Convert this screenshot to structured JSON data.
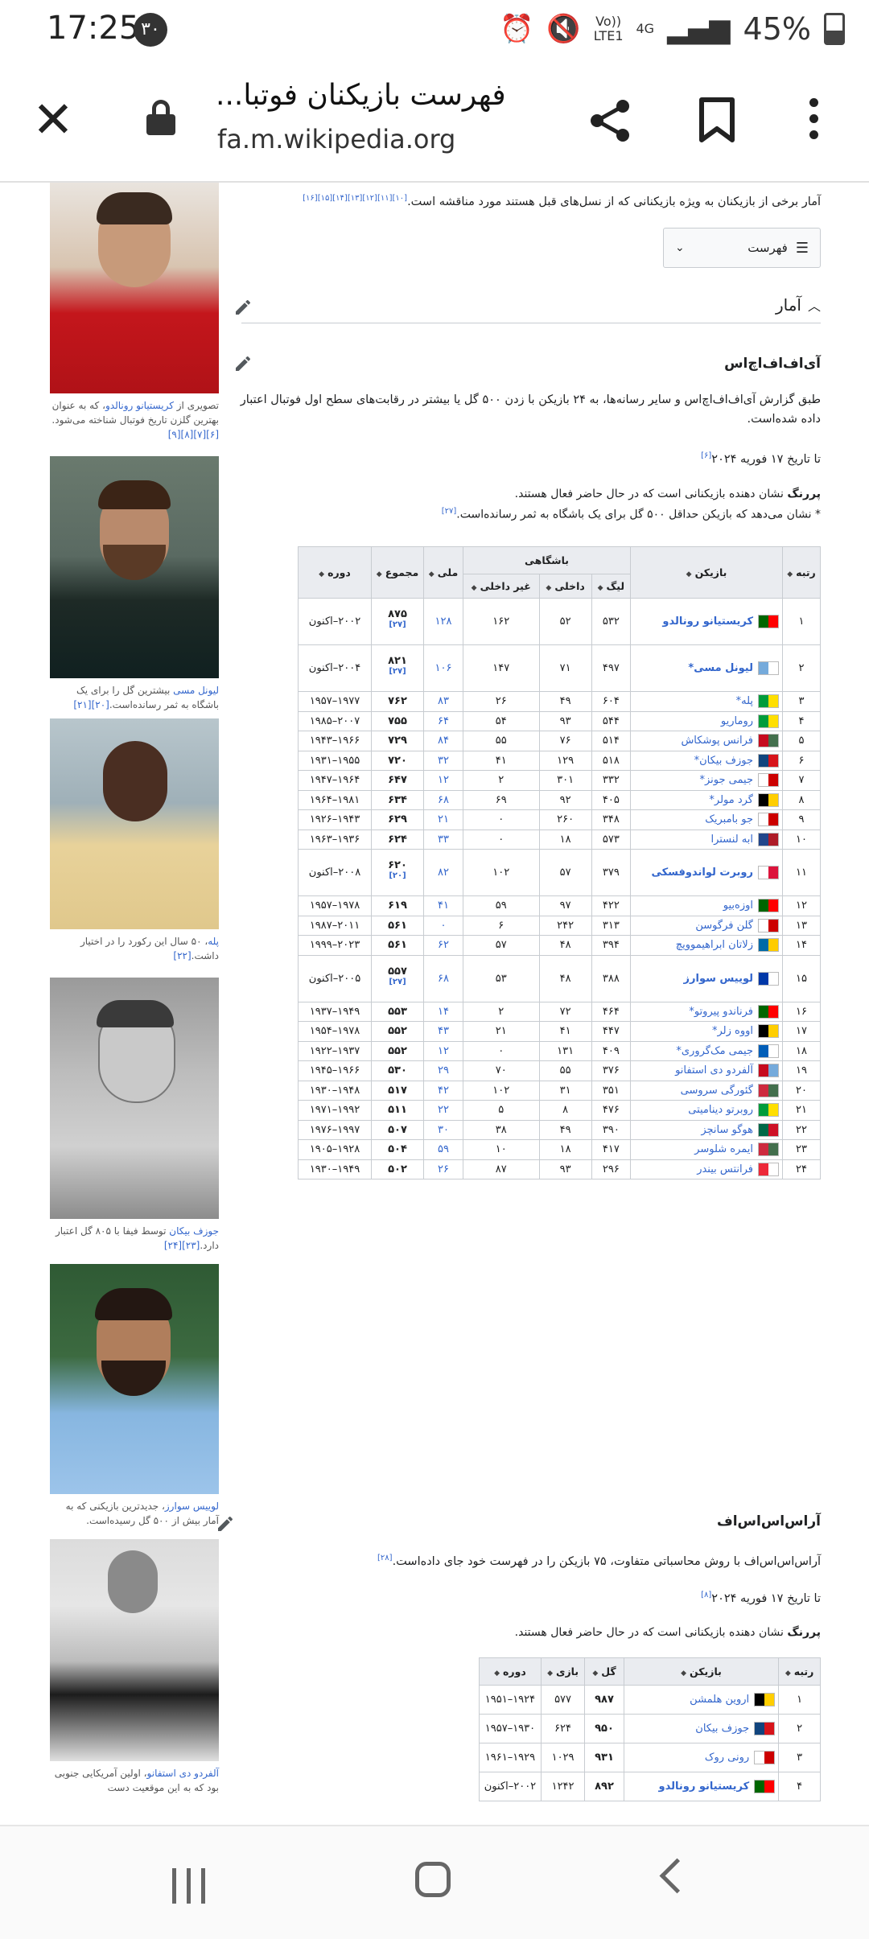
{
  "status": {
    "time": "17:25",
    "badge": "۳۰",
    "net_top": "Vo))",
    "net_bottom": "LTE1",
    "gen": "4G",
    "battery": "45%"
  },
  "browser": {
    "title": "فهرست بازیکنان فوتبا...",
    "url": "fa.m.wikipedia.org"
  },
  "intro": {
    "text": "آمار برخی از بازیکنان به ویژه بازیکنانی که از نسل‌های قبل هستند مورد مناقشه است.",
    "refs": "[۱۰][۱۱][۱۲][۱۳][۱۴][۱۵][۱۶]"
  },
  "toc": {
    "label": "فهرست"
  },
  "section": {
    "title": "آمار"
  },
  "iffhs": {
    "title": "آی‌اف‌اف‌اچ‌اس",
    "para": "طبق گزارش آی‌اف‌اف‌اچ‌اس و سایر رسانه‌ها، به ۲۴ بازیکن با زدن ۵۰۰ گل یا بیشتر در رقابت‌های سطح اول فوتبال اعتبار داده شده‌است.",
    "asof": "تا تاریخ ۱۷ فوریه ۲۰۲۴",
    "asof_ref": "[۶]",
    "legend_bold": "پررنگ",
    "legend_rest": " نشان دهنده بازیکنانی است که در حال حاضر فعال هستند.",
    "legend2": "* نشان می‌دهد که بازیکن حداقل ۵۰۰ گل برای یک باشگاه به ثمر رسانده‌است.",
    "legend2_ref": "[۲۷]",
    "headers": {
      "rank": "رتبه",
      "player": "بازیکن",
      "clubs": "باشگاهی",
      "league": "لیگ",
      "domestic": "داخلی",
      "nondomestic": "غیر داخلی",
      "national": "ملی",
      "total": "مجموع",
      "period": "دوره"
    },
    "rows": [
      {
        "rank": "۱",
        "name": "کریستیانو رونالدو",
        "bold": true,
        "colors": [
          "#006600",
          "#ff0000"
        ],
        "league": "۵۳۲",
        "dom": "۵۲",
        "nondom": "۱۶۲",
        "nat": "۱۲۸",
        "total": "۸۷۵",
        "ref": "[۲۷]",
        "period": "۲۰۰۲–اکنون",
        "tall": true
      },
      {
        "rank": "۲",
        "name": "لیونل مسی*",
        "bold": true,
        "colors": [
          "#75aadb",
          "#ffffff"
        ],
        "league": "۴۹۷",
        "dom": "۷۱",
        "nondom": "۱۴۷",
        "nat": "۱۰۶",
        "total": "۸۲۱",
        "ref": "[۲۷]",
        "period": "۲۰۰۴–اکنون",
        "tall": true
      },
      {
        "rank": "۳",
        "name": "پله*",
        "bold": false,
        "colors": [
          "#009c3b",
          "#ffdf00"
        ],
        "league": "۶۰۴",
        "dom": "۴۹",
        "nondom": "۲۶",
        "nat": "۸۳",
        "total": "۷۶۲",
        "ref": "",
        "period": "۱۹۷۷–۱۹۵۷",
        "tall": false
      },
      {
        "rank": "۴",
        "name": "روماریو",
        "bold": false,
        "colors": [
          "#009c3b",
          "#ffdf00"
        ],
        "league": "۵۴۴",
        "dom": "۹۳",
        "nondom": "۵۴",
        "nat": "۶۴",
        "total": "۷۵۵",
        "ref": "",
        "period": "۲۰۰۷–۱۹۸۵",
        "tall": false
      },
      {
        "rank": "۵",
        "name": "فرانس پوشکاش",
        "bold": false,
        "colors": [
          "#c60b1e",
          "#436f4d"
        ],
        "league": "۵۱۴",
        "dom": "۷۶",
        "nondom": "۵۵",
        "nat": "۸۴",
        "total": "۷۲۹",
        "ref": "",
        "period": "۱۹۶۶–۱۹۴۳",
        "tall": false
      },
      {
        "rank": "۶",
        "name": "جوزف بیکان*",
        "bold": false,
        "colors": [
          "#11457e",
          "#d7141a"
        ],
        "league": "۵۱۸",
        "dom": "۱۲۹",
        "nondom": "۴۱",
        "nat": "۳۲",
        "total": "۷۲۰",
        "ref": "",
        "period": "۱۹۵۵–۱۹۳۱",
        "tall": false
      },
      {
        "rank": "۷",
        "name": "جیمی جونز*",
        "bold": false,
        "colors": [
          "#ffffff",
          "#cc0000"
        ],
        "league": "۳۳۲",
        "dom": "۳۰۱",
        "nondom": "۲",
        "nat": "۱۲",
        "total": "۶۴۷",
        "ref": "",
        "period": "۱۹۶۴–۱۹۴۷",
        "tall": false
      },
      {
        "rank": "۸",
        "name": "گرد مولر*",
        "bold": false,
        "colors": [
          "#000000",
          "#ffce00"
        ],
        "league": "۴۰۵",
        "dom": "۹۲",
        "nondom": "۶۹",
        "nat": "۶۸",
        "total": "۶۳۴",
        "ref": "",
        "period": "۱۹۸۱–۱۹۶۴",
        "tall": false
      },
      {
        "rank": "۹",
        "name": "جو بامبریک",
        "bold": false,
        "colors": [
          "#ffffff",
          "#cc0000"
        ],
        "league": "۳۴۸",
        "dom": "۲۶۰",
        "nondom": "۰",
        "nat": "۲۱",
        "total": "۶۲۹",
        "ref": "",
        "period": "۱۹۴۳–۱۹۲۶",
        "tall": false
      },
      {
        "rank": "۱۰",
        "name": "ابه لنسترا",
        "bold": false,
        "colors": [
          "#21468b",
          "#ae1c28"
        ],
        "league": "۵۷۳",
        "dom": "۱۸",
        "nondom": "۰",
        "nat": "۳۳",
        "total": "۶۲۴",
        "ref": "",
        "period": "۱۹۳۶–۱۹۶۳",
        "tall": false
      },
      {
        "rank": "۱۱",
        "name": "روبرت لواندوفسکی",
        "bold": true,
        "colors": [
          "#ffffff",
          "#dc143c"
        ],
        "league": "۳۷۹",
        "dom": "۵۷",
        "nondom": "۱۰۲",
        "nat": "۸۲",
        "total": "۶۲۰",
        "ref": "[۲۰]",
        "period": "۲۰۰۸–اکنون",
        "tall": true
      },
      {
        "rank": "۱۲",
        "name": "اوزه‌بیو",
        "bold": false,
        "colors": [
          "#006600",
          "#ff0000"
        ],
        "league": "۴۲۲",
        "dom": "۹۷",
        "nondom": "۵۹",
        "nat": "۴۱",
        "total": "۶۱۹",
        "ref": "",
        "period": "۱۹۷۸–۱۹۵۷",
        "tall": false
      },
      {
        "rank": "۱۳",
        "name": "گلن فرگوسن",
        "bold": false,
        "colors": [
          "#ffffff",
          "#cc0000"
        ],
        "league": "۳۱۳",
        "dom": "۲۴۲",
        "nondom": "۶",
        "nat": "۰",
        "total": "۵۶۱",
        "ref": "",
        "period": "۲۰۱۱–۱۹۸۷",
        "tall": false
      },
      {
        "rank": "۱۴",
        "name": "زلاتان ابراهیموویچ",
        "bold": false,
        "colors": [
          "#006aa7",
          "#fecc00"
        ],
        "league": "۳۹۴",
        "dom": "۴۸",
        "nondom": "۵۷",
        "nat": "۶۲",
        "total": "۵۶۱",
        "ref": "",
        "period": "۲۰۲۳–۱۹۹۹",
        "tall": false
      },
      {
        "rank": "۱۵",
        "name": "لوییس سوارز",
        "bold": true,
        "colors": [
          "#0038a8",
          "#ffffff"
        ],
        "league": "۳۸۸",
        "dom": "۴۸",
        "nondom": "۵۳",
        "nat": "۶۸",
        "total": "۵۵۷",
        "ref": "[۲۷]",
        "period": "۲۰۰۵–اکنون",
        "tall": true
      },
      {
        "rank": "۱۶",
        "name": "فرناندو پیروتو*",
        "bold": false,
        "colors": [
          "#006600",
          "#ff0000"
        ],
        "league": "۴۶۴",
        "dom": "۷۲",
        "nondom": "۲",
        "nat": "۱۴",
        "total": "۵۵۳",
        "ref": "",
        "period": "۱۹۴۹–۱۹۳۷",
        "tall": false
      },
      {
        "rank": "۱۷",
        "name": "اووه زلر*",
        "bold": false,
        "colors": [
          "#000000",
          "#ffce00"
        ],
        "league": "۴۴۷",
        "dom": "۴۱",
        "nondom": "۲۱",
        "nat": "۴۳",
        "total": "۵۵۲",
        "ref": "",
        "period": "۱۹۷۸–۱۹۵۴",
        "tall": false
      },
      {
        "rank": "۱۸",
        "name": "جیمی مک‌گروری*",
        "bold": false,
        "colors": [
          "#005eb8",
          "#ffffff"
        ],
        "league": "۴۰۹",
        "dom": "۱۳۱",
        "nondom": "۰",
        "nat": "۱۲",
        "total": "۵۵۲",
        "ref": "",
        "period": "۱۹۳۷–۱۹۲۲",
        "tall": false
      },
      {
        "rank": "۱۹",
        "name": "آلفردو دی استفانو",
        "bold": false,
        "colors": [
          "#c60b1e",
          "#75aadb"
        ],
        "league": "۳۷۶",
        "dom": "۵۵",
        "nondom": "۷۰",
        "nat": "۲۹",
        "total": "۵۳۰",
        "ref": "",
        "period": "۱۹۶۶–۱۹۴۵",
        "tall": false
      },
      {
        "rank": "۲۰",
        "name": "گئورگی سروسی",
        "bold": false,
        "colors": [
          "#cd2a3e",
          "#436f4d"
        ],
        "league": "۳۵۱",
        "dom": "۳۱",
        "nondom": "۱۰۲",
        "nat": "۴۲",
        "total": "۵۱۷",
        "ref": "",
        "period": "۱۹۴۸–۱۹۳۰",
        "tall": false
      },
      {
        "rank": "۲۱",
        "name": "روبرتو دینامیتی",
        "bold": false,
        "colors": [
          "#009c3b",
          "#ffdf00"
        ],
        "league": "۴۷۶",
        "dom": "۸",
        "nondom": "۵",
        "nat": "۲۲",
        "total": "۵۱۱",
        "ref": "",
        "period": "۱۹۹۲–۱۹۷۱",
        "tall": false
      },
      {
        "rank": "۲۲",
        "name": "هوگو سانچز",
        "bold": false,
        "colors": [
          "#006847",
          "#ce1126"
        ],
        "league": "۳۹۰",
        "dom": "۴۹",
        "nondom": "۳۸",
        "nat": "۳۰",
        "total": "۵۰۷",
        "ref": "",
        "period": "۱۹۹۷–۱۹۷۶",
        "tall": false
      },
      {
        "rank": "۲۳",
        "name": "ایمره شلوسر",
        "bold": false,
        "colors": [
          "#cd2a3e",
          "#436f4d"
        ],
        "league": "۴۱۷",
        "dom": "۱۸",
        "nondom": "۱۰",
        "nat": "۵۹",
        "total": "۵۰۴",
        "ref": "",
        "period": "۱۹۲۸–۱۹۰۵",
        "tall": false
      },
      {
        "rank": "۲۴",
        "name": "فرانتس بیندر",
        "bold": false,
        "colors": [
          "#ed2939",
          "#ffffff"
        ],
        "league": "۲۹۶",
        "dom": "۹۳",
        "nondom": "۸۷",
        "nat": "۲۶",
        "total": "۵۰۲",
        "ref": "",
        "period": "۱۹۴۹–۱۹۳۰",
        "tall": false
      }
    ]
  },
  "rsssf": {
    "title": "آراس‌اس‌اس‌اف",
    "para": "آراس‌اس‌اس‌اف با روش محاسباتی متفاوت، ۷۵ بازیکن را در فهرست خود جای داده‌است.",
    "para_ref": "[۲۸]",
    "asof": "تا تاریخ ۱۷ فوریه ۲۰۲۴",
    "asof_ref": "[۸]",
    "legend_bold": "پررنگ",
    "legend_rest": " نشان دهنده بازیکنانی است که در حال حاضر فعال هستند.",
    "headers": {
      "rank": "رتبه",
      "player": "بازیکن",
      "goals": "گل",
      "games": "بازی",
      "period": "دوره"
    },
    "rows": [
      {
        "rank": "۱",
        "name": "اروین هلمشن",
        "bold": false,
        "colors": [
          "#000000",
          "#ffce00"
        ],
        "goals": "۹۸۷",
        "games": "۵۷۷",
        "period": "۱۹۲۴–۱۹۵۱"
      },
      {
        "rank": "۲",
        "name": "جوزف بیکان",
        "bold": false,
        "colors": [
          "#11457e",
          "#d7141a"
        ],
        "goals": "۹۵۰",
        "games": "۶۲۴",
        "period": "۱۹۳۰–۱۹۵۷"
      },
      {
        "rank": "۳",
        "name": "رونی روک",
        "bold": false,
        "colors": [
          "#ffffff",
          "#cc0000"
        ],
        "goals": "۹۳۱",
        "games": "۱۰۲۹",
        "period": "۱۹۲۹–۱۹۶۱"
      },
      {
        "rank": "۴",
        "name": "کریستیانو رونالدو",
        "bold": true,
        "colors": [
          "#006600",
          "#ff0000"
        ],
        "goals": "۸۹۲",
        "games": "۱۲۴۲",
        "period": "۲۰۰۲–اکنون"
      }
    ]
  },
  "captions": [
    {
      "pre": "تصویری از ",
      "link": "کریستیانو رونالدو",
      "post": "، که به عنوان بهترین گلزن تاریخ فوتبال شناخته می‌شود.",
      "refs": "[۶][۷][۸][۹]"
    },
    {
      "pre": "",
      "link": "لیونل مسی",
      "post": " بیشترین گل را برای یک باشگاه به ثمر رسانده‌است.",
      "refs": "[۲۰][۲۱]"
    },
    {
      "pre": "",
      "link": "پله",
      "post": "، ۵۰ سال این رکورد را در اختیار داشت.",
      "refs": "[۲۲]"
    },
    {
      "pre": "",
      "link": "جوزف بیکان",
      "post": " توسط فیفا با ۸۰۵ گل اعتبار دارد.",
      "refs": "[۲۳][۲۴]"
    },
    {
      "pre": "",
      "link": "لوییس سوارز",
      "post": "، جدیدترین بازیکنی که به آمار بیش از ۵۰۰ گل رسیده‌است.",
      "refs": ""
    },
    {
      "pre": "",
      "link": "آلفردو دی استفانو",
      "post": "، اولین آمریکایی جنوبی بود که به این موقعیت دست",
      "refs": ""
    }
  ]
}
